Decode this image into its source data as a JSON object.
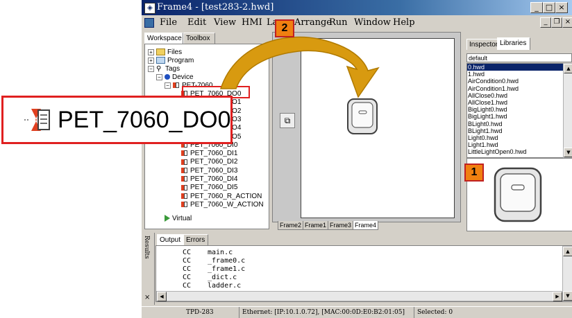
{
  "window": {
    "title": "Frame4 - [test283-2.hwd]"
  },
  "menu": [
    "File",
    "Edit",
    "View",
    "HMI",
    "Lay",
    "Arrange",
    "Run",
    "Window",
    "Help"
  ],
  "workspace_tabs": [
    "Workspace",
    "Toolbox"
  ],
  "tree": {
    "files": "Files",
    "program": "Program",
    "tags": "Tags",
    "device": "Device",
    "module": "PET-7060",
    "items": [
      "PET_7060_DO0",
      "PET_7060_DO1",
      "PET_7060_DO2",
      "PET_7060_DO3",
      "PET_7060_DO4",
      "PET_7060_DO5",
      "PET_7060_DI0",
      "PET_7060_DI1",
      "PET_7060_DI2",
      "PET_7060_DI3",
      "PET_7060_DI4",
      "PET_7060_DI5",
      "PET_7060_R_ACTION",
      "PET_7060_W_ACTION"
    ],
    "virtual": "Virtual"
  },
  "frame_tabs": [
    "Frame2",
    "Frame1",
    "Frame3",
    "Frame4"
  ],
  "right_tabs": [
    "Inspector",
    "Libraries"
  ],
  "library": {
    "selected": "default",
    "items": [
      "0.hwd",
      "1.hwd",
      "AirCondition0.hwd",
      "AirCondition1.hwd",
      "AllClose0.hwd",
      "AllClose1.hwd",
      "BigLight0.hwd",
      "BigLight1.hwd",
      "BLight0.hwd",
      "BLight1.hwd",
      "Light0.hwd",
      "Light1.hwd",
      "LittleLightOpen0.hwd"
    ]
  },
  "output": {
    "side_label": "Results",
    "tabs": [
      "Output",
      "Errors"
    ],
    "lines": [
      {
        "cmd": "CC",
        "file": "main.c"
      },
      {
        "cmd": "CC",
        "file": "_frame0.c"
      },
      {
        "cmd": "CC",
        "file": "_frame1.c"
      },
      {
        "cmd": "CC",
        "file": "_dict.c"
      },
      {
        "cmd": "CC",
        "file": "ladder.c"
      }
    ]
  },
  "status": {
    "device": "TPD-283",
    "ethernet": "Ethernet: [IP:10.1.0.72], [MAC:00:0D:E0:B2:01:05]",
    "selected": "Selected: 0"
  },
  "callout": {
    "label": "PET_7060_DO0"
  },
  "badges": {
    "one": "1",
    "two": "2"
  },
  "colors": {
    "title_bar": "#0a246a",
    "highlight": "#e02020",
    "badge": "#f08010",
    "arrow": "#d89a10",
    "selection": "#0a246a"
  }
}
